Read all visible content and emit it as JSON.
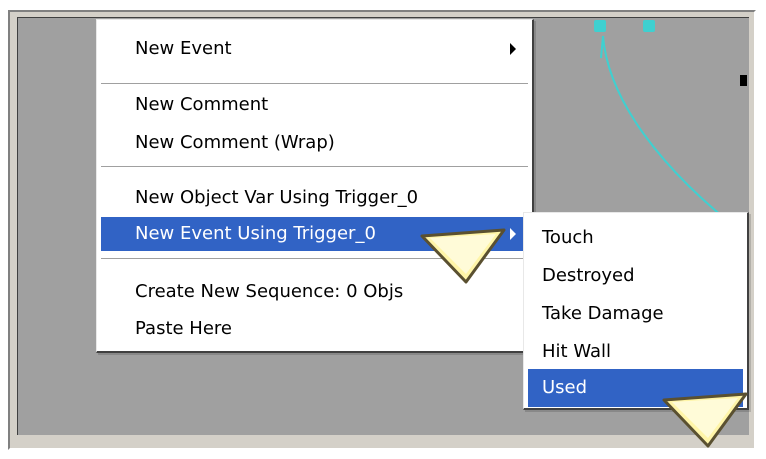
{
  "main_menu": {
    "items": [
      {
        "label": "New Event",
        "has_submenu": true
      },
      {
        "label": "New Comment"
      },
      {
        "label": "New Comment (Wrap)"
      },
      {
        "label": "New Object Var Using Trigger_0"
      },
      {
        "label": "New Event Using Trigger_0",
        "has_submenu": true,
        "highlighted": true
      },
      {
        "label": "Create New Sequence: 0 Objs"
      },
      {
        "label": "Paste Here"
      }
    ]
  },
  "sub_menu": {
    "items": [
      {
        "label": "Touch"
      },
      {
        "label": "Destroyed"
      },
      {
        "label": "Take Damage"
      },
      {
        "label": "Hit Wall"
      },
      {
        "label": "Used",
        "highlighted": true
      }
    ]
  },
  "colors": {
    "highlight": "#3163c5",
    "canvas": "#a0a0a0",
    "connector": "#3fd0d0",
    "pointer": "#fff5a8"
  },
  "icons": {
    "submenu_arrow": "submenu-arrow-icon",
    "pointer": "yellow-pointer-callout-icon"
  }
}
